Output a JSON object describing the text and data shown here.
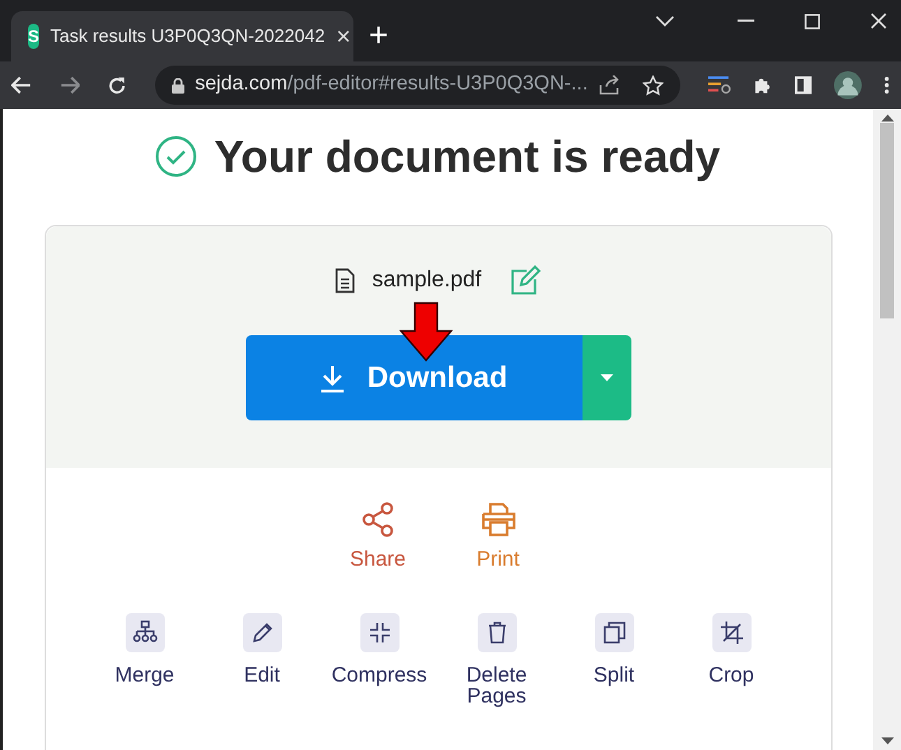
{
  "browser": {
    "tab": {
      "favicon": "S",
      "title": "Task results U3P0Q3QN-2022042",
      "close": "×",
      "selected": true
    },
    "new_tab": "+",
    "address": {
      "domain": "sejda.com",
      "path": "/pdf-editor#results-U3P0Q3QN-..."
    }
  },
  "heading": "Your document is ready",
  "file": {
    "name": "sample.pdf"
  },
  "download": {
    "label": "Download"
  },
  "actions": [
    {
      "kind": "share",
      "label": "Share",
      "color": "#c8573f"
    },
    {
      "kind": "print",
      "label": "Print",
      "color": "#d97c2e"
    }
  ],
  "tools": [
    {
      "kind": "merge",
      "label": "Merge"
    },
    {
      "kind": "edit",
      "label": "Edit"
    },
    {
      "kind": "compress",
      "label": "Compress"
    },
    {
      "kind": "delete",
      "label": "Delete Pages"
    },
    {
      "kind": "split",
      "label": "Split"
    },
    {
      "kind": "crop",
      "label": "Crop"
    }
  ]
}
